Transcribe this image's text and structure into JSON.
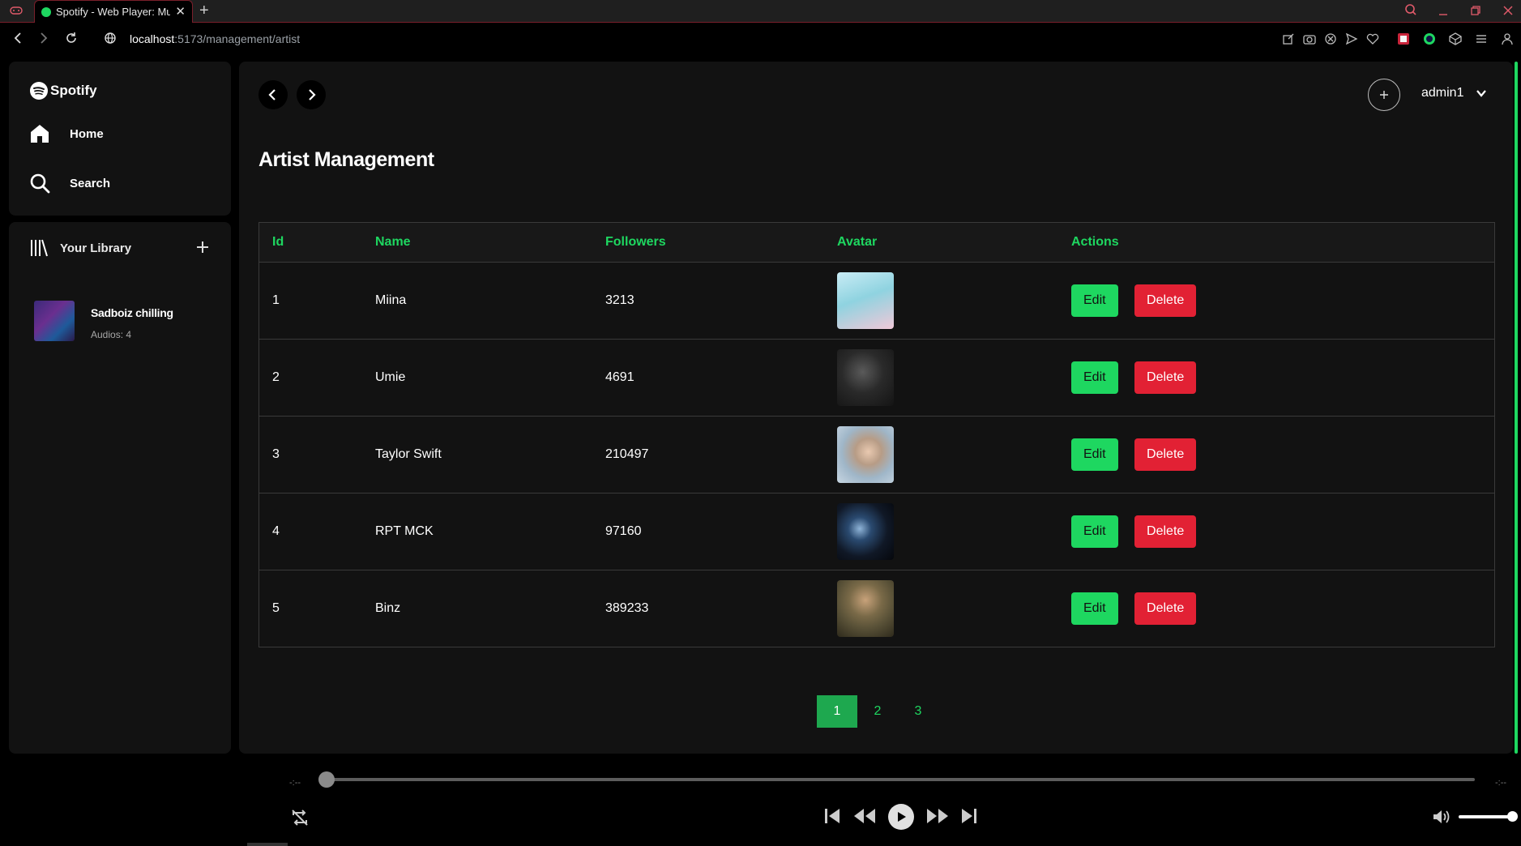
{
  "browser": {
    "tab_title": "Spotify - Web Player: Music",
    "url_host": "localhost",
    "url_rest": ":5173/management/artist"
  },
  "sidebar": {
    "logo_text": "Spotify",
    "nav": [
      {
        "label": "Home",
        "icon": "home-icon"
      },
      {
        "label": "Search",
        "icon": "search-icon"
      }
    ],
    "library": {
      "title": "Your Library",
      "playlists": [
        {
          "title": "Sadboiz chilling",
          "subtitle": "Audios: 4"
        }
      ]
    }
  },
  "header": {
    "username": "admin1"
  },
  "main": {
    "title": "Artist Management",
    "columns": [
      "Id",
      "Name",
      "Followers",
      "Avatar",
      "Actions"
    ],
    "rows": [
      {
        "id": "1",
        "name": "Miina",
        "followers": "3213",
        "avatar_color": "#8fd3e0"
      },
      {
        "id": "2",
        "name": "Umie",
        "followers": "4691",
        "avatar_color": "#2a2a2a"
      },
      {
        "id": "3",
        "name": "Taylor Swift",
        "followers": "210497",
        "avatar_color": "#9fb6c8"
      },
      {
        "id": "4",
        "name": "RPT MCK",
        "followers": "97160",
        "avatar_color": "#101826"
      },
      {
        "id": "5",
        "name": "Binz",
        "followers": "389233",
        "avatar_color": "#5a5238"
      }
    ],
    "edit_label": "Edit",
    "delete_label": "Delete",
    "pages": [
      "1",
      "2",
      "3"
    ],
    "current_page": "1"
  },
  "player": {
    "time_elapsed": "-:--",
    "time_total": "-:--"
  },
  "colors": {
    "accent": "#1ed760",
    "danger": "#e22134",
    "surface": "#121212"
  }
}
